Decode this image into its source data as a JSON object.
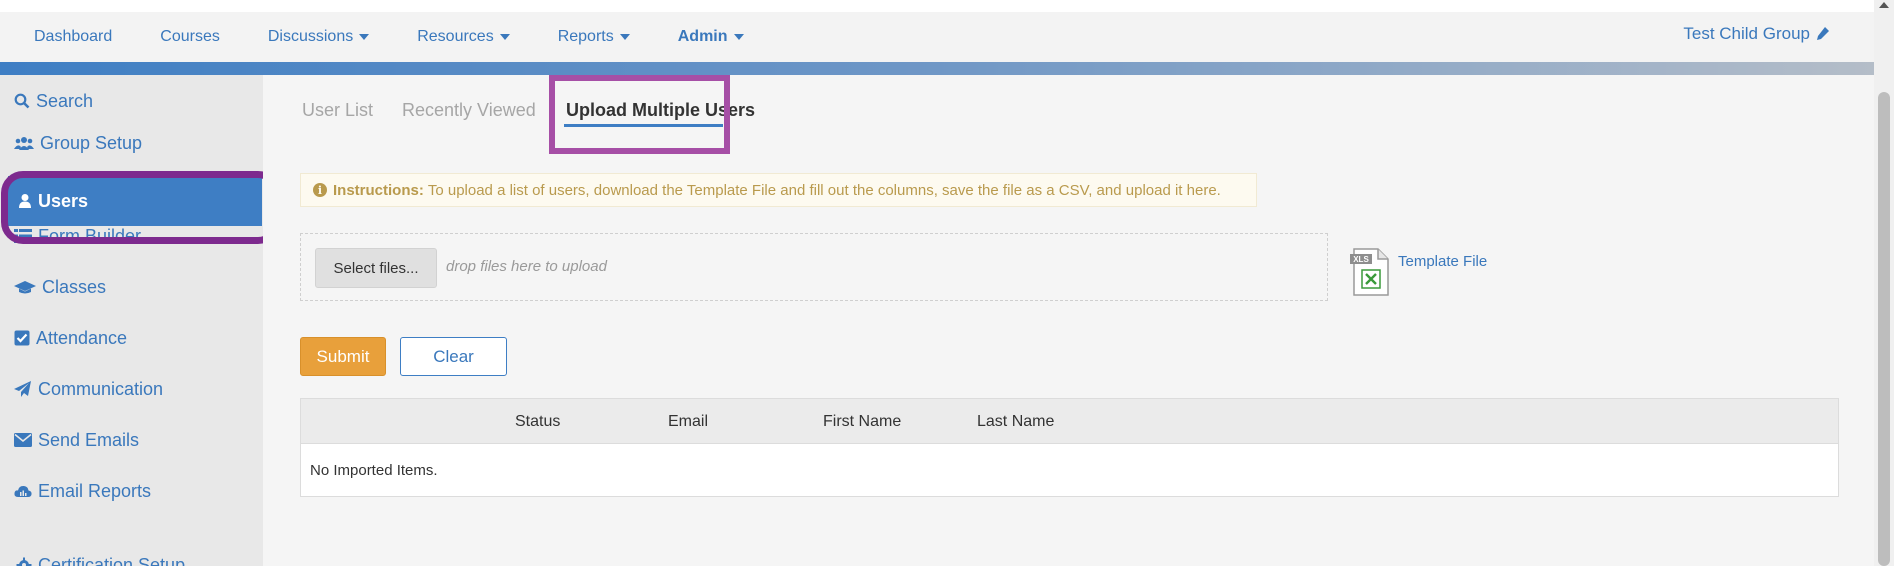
{
  "topnav": {
    "items": [
      {
        "label": "Dashboard",
        "dropdown": false
      },
      {
        "label": "Courses",
        "dropdown": false
      },
      {
        "label": "Discussions",
        "dropdown": true
      },
      {
        "label": "Resources",
        "dropdown": true
      },
      {
        "label": "Reports",
        "dropdown": true
      },
      {
        "label": "Admin",
        "dropdown": true
      }
    ],
    "group_name": "Test Child Group"
  },
  "sidebar": {
    "items": [
      {
        "label": "Search",
        "icon": "search-icon"
      },
      {
        "label": "Group Setup",
        "icon": "users-group-icon"
      },
      {
        "label": "Users",
        "icon": "user-icon",
        "active": true
      },
      {
        "label": "Form Builder",
        "icon": "list-icon"
      },
      {
        "label": "Classes",
        "icon": "graduation-cap-icon"
      },
      {
        "label": "Attendance",
        "icon": "check-square-icon"
      },
      {
        "label": "Communication",
        "icon": "paper-plane-icon"
      },
      {
        "label": "Send Emails",
        "icon": "envelope-icon"
      },
      {
        "label": "Email Reports",
        "icon": "cloud-chart-icon"
      },
      {
        "label": "Certification Setup",
        "icon": "gear-icon"
      }
    ]
  },
  "tabs": [
    {
      "label": "User List",
      "active": false
    },
    {
      "label": "Recently Viewed",
      "active": false
    },
    {
      "label": "Upload Multiple Users",
      "active": true
    }
  ],
  "instructions": {
    "icon_text": "i",
    "title": "Instructions:",
    "text": "To upload a list of users, download the Template File and fill out the columns, save the file as a CSV, and upload it here."
  },
  "upload": {
    "select_label": "Select files...",
    "drop_text": "drop files here to upload",
    "template_label": "Template File",
    "file_icon_text": "XLS"
  },
  "actions": {
    "submit_label": "Submit",
    "clear_label": "Clear"
  },
  "table": {
    "columns": [
      "Status",
      "Email",
      "First Name",
      "Last Name"
    ],
    "empty_text": "No Imported Items."
  },
  "colors": {
    "accent": "#3e7ec4",
    "submit": "#e8a03b",
    "highlight_users": "#7d2a8e",
    "highlight_tab": "#a64fa6"
  }
}
